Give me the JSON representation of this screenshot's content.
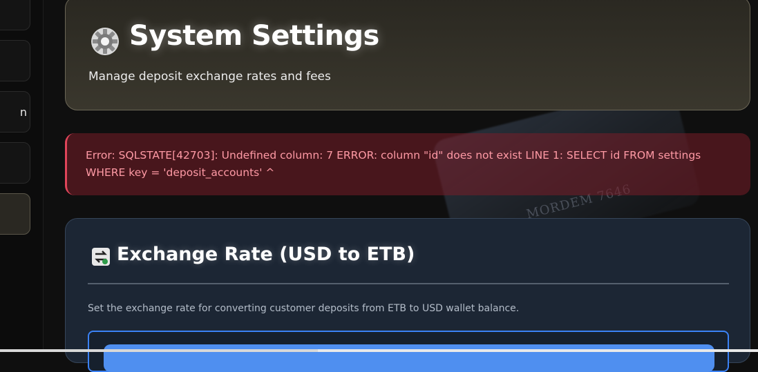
{
  "header": {
    "title": "System Settings",
    "subtitle": "Manage deposit exchange rates and fees"
  },
  "sidebar": {
    "items": [
      {
        "label": ""
      },
      {
        "label": ""
      },
      {
        "label": "n"
      },
      {
        "label": ""
      },
      {
        "label": "",
        "active": true
      }
    ]
  },
  "alert": {
    "message": "Error: SQLSTATE[42703]: Undefined column: 7 ERROR: column \"id\" does not exist LINE 1: SELECT id FROM settings WHERE key = 'deposit_accounts' ^"
  },
  "exchange": {
    "title": "Exchange Rate (USD to ETB)",
    "description": "Set the exchange rate for converting customer deposits from ETB to USD wallet balance."
  },
  "background": {
    "card_text": "MORDEM  7646"
  },
  "colors": {
    "accent": "#3b82f6",
    "error": "#e0455a",
    "header_border": "#6b6656"
  },
  "icons": {
    "header": "gear-icon",
    "exchange": "exchange-arrows-icon"
  }
}
